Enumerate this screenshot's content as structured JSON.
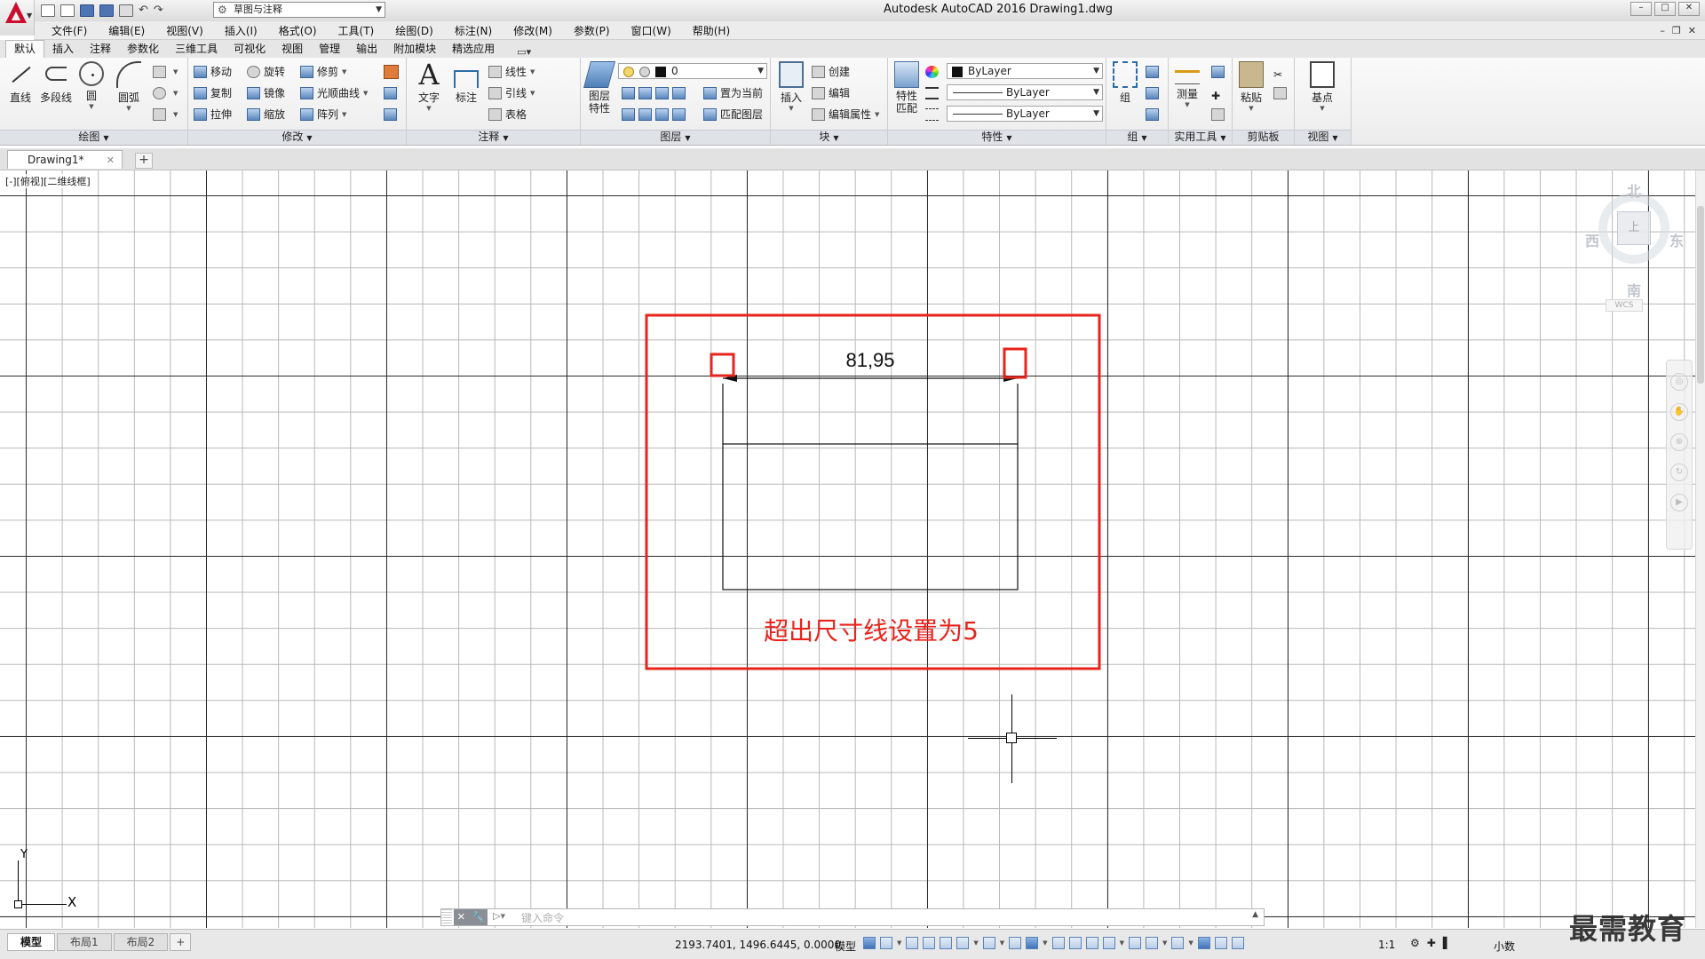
{
  "title": "Autodesk AutoCAD 2016    Drawing1.dwg",
  "workspace": "草图与注释",
  "menu": [
    "文件(F)",
    "编辑(E)",
    "视图(V)",
    "插入(I)",
    "格式(O)",
    "工具(T)",
    "绘图(D)",
    "标注(N)",
    "修改(M)",
    "参数(P)",
    "窗口(W)",
    "帮助(H)"
  ],
  "ribbon_tabs": [
    "默认",
    "插入",
    "注释",
    "参数化",
    "三维工具",
    "可视化",
    "视图",
    "管理",
    "输出",
    "附加模块",
    "精选应用"
  ],
  "panels": {
    "draw": {
      "title": "绘图",
      "line": "直线",
      "polyline": "多段线",
      "circle": "圆",
      "arc": "圆弧"
    },
    "modify": {
      "title": "修改",
      "move": "移动",
      "rotate": "旋转",
      "trim": "修剪",
      "copy": "复制",
      "mirror": "镜像",
      "fillet": "光顺曲线",
      "stretch": "拉伸",
      "scale": "缩放",
      "array": "阵列"
    },
    "annotation": {
      "title": "注释",
      "text": "文字",
      "dimension": "标注",
      "linear": "线性",
      "leader": "引线",
      "table": "表格"
    },
    "layers": {
      "title": "图层",
      "properties": "图层\n特性",
      "current_layer": "0",
      "set_current": "置为当前",
      "match_layer": "匹配图层"
    },
    "block": {
      "title": "块",
      "insert": "插入",
      "create": "创建",
      "edit": "编辑",
      "edit_attr": "编辑属性"
    },
    "properties": {
      "title": "特性",
      "match": "特性\n匹配",
      "color": "ByLayer",
      "linetype": "ByLayer",
      "lineweight": "ByLayer"
    },
    "groups": {
      "title": "组",
      "group": "组"
    },
    "utilities": {
      "title": "实用工具",
      "measure": "测量"
    },
    "clipboard": {
      "title": "剪贴板",
      "paste": "粘贴"
    },
    "view": {
      "title": "视图",
      "base": "基点"
    }
  },
  "doc_tab": "Drawing1*",
  "viewport_label": "[-][俯视][二维线框]",
  "viewcube": {
    "n": "北",
    "s": "南",
    "w": "西",
    "e": "东",
    "face": "上",
    "wcs": "WCS"
  },
  "drawing": {
    "dimension_text": "81,95",
    "annotation": "超出尺寸线设置为5",
    "annotation_color": "#e8231c"
  },
  "ucs": {
    "x": "X",
    "y": "Y"
  },
  "command": {
    "placeholder": "键入命令"
  },
  "layout_tabs": [
    "模型",
    "布局1",
    "布局2"
  ],
  "status": {
    "coords": "2193.7401, 1496.6445, 0.0000",
    "model": "模型",
    "scale": "1:1",
    "units": "小数"
  },
  "watermark": "最需教育"
}
